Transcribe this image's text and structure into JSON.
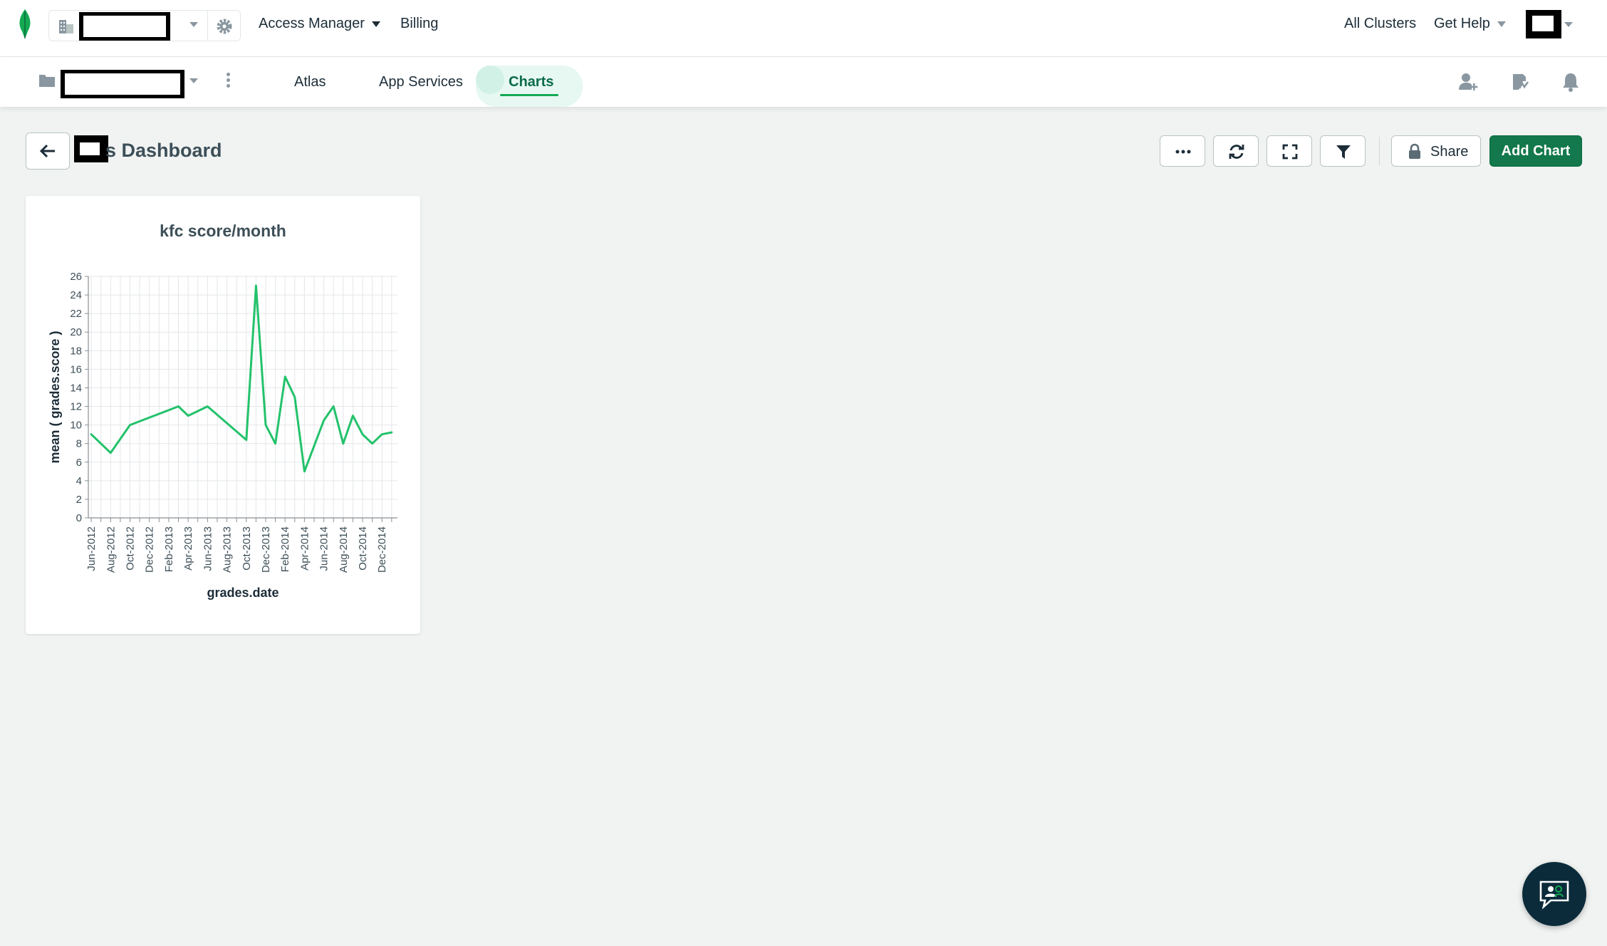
{
  "topbar": {
    "access_manager": "Access Manager",
    "billing": "Billing",
    "all_clusters": "All Clusters",
    "get_help": "Get Help"
  },
  "subbar": {
    "tabs": [
      {
        "label": "Atlas",
        "active": false
      },
      {
        "label": "App Services",
        "active": false
      },
      {
        "label": "Charts",
        "active": true
      }
    ]
  },
  "dashboard": {
    "title_suffix": "s Dashboard",
    "share_label": "Share",
    "add_chart_label": "Add Chart"
  },
  "colors": {
    "accent": "#13aa52",
    "add_button": "#13784b",
    "line": "#23c26b",
    "chat_bubble": "#0b2b3a"
  },
  "chart_data": {
    "type": "line",
    "title": "kfc score/month",
    "xlabel": "grades.date",
    "ylabel": "mean ( grades.score )",
    "ylim": [
      0,
      26
    ],
    "yticks": [
      0,
      2,
      4,
      6,
      8,
      10,
      12,
      14,
      16,
      18,
      20,
      22,
      24,
      26
    ],
    "xtick_labels": [
      "Jun-2012",
      "Aug-2012",
      "Oct-2012",
      "Dec-2012",
      "Feb-2013",
      "Apr-2013",
      "Jun-2013",
      "Aug-2013",
      "Oct-2013",
      "Dec-2013",
      "Feb-2014",
      "Apr-2014",
      "Jun-2014",
      "Aug-2014",
      "Oct-2014",
      "Dec-2014"
    ],
    "grid": true,
    "series": [
      {
        "color": "#23c26b",
        "x": [
          "2012-06",
          "2012-07",
          "2012-08",
          "2012-10",
          "2013-03",
          "2013-04",
          "2013-05",
          "2013-06",
          "2013-10",
          "2013-11",
          "2013-12",
          "2014-01",
          "2014-02",
          "2014-03",
          "2014-04",
          "2014-06",
          "2014-07",
          "2014-08",
          "2014-09",
          "2014-10",
          "2014-11",
          "2014-12",
          "2015-01"
        ],
        "values": [
          9,
          8,
          7,
          10,
          12,
          11,
          11.5,
          12,
          8.4,
          25,
          10,
          8,
          15.2,
          13,
          5,
          10.5,
          12,
          8,
          11,
          9,
          8,
          9,
          9.2
        ]
      }
    ]
  }
}
